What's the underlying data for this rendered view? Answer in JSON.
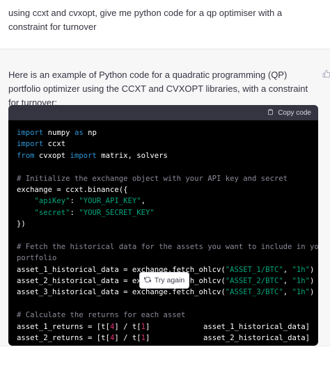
{
  "user_message": {
    "text": "using ccxt and cvxopt, give me python code for a qp optimiser with a constraint for turnover"
  },
  "assistant_message": {
    "intro": "Here is an example of Python code for a quadratic programming (QP) portfolio optimizer using the CCXT and CVXOPT libraries, with a constraint for turnover:",
    "feedback_icon": "thumbs-up-icon"
  },
  "code_block": {
    "copy_label": "Copy code",
    "copy_icon": "clipboard-icon",
    "lines": [
      [
        {
          "t": "kw",
          "v": "import"
        },
        {
          "v": " numpy "
        },
        {
          "t": "kw",
          "v": "as"
        },
        {
          "v": " np"
        }
      ],
      [
        {
          "t": "kw",
          "v": "import"
        },
        {
          "v": " ccxt"
        }
      ],
      [
        {
          "t": "kw",
          "v": "from"
        },
        {
          "v": " cvxopt "
        },
        {
          "t": "kw",
          "v": "import"
        },
        {
          "v": " matrix, solvers"
        }
      ],
      [],
      [
        {
          "t": "cm",
          "v": "# Initialize the exchange object with your API key and secret"
        }
      ],
      [
        {
          "v": "exchange = ccxt.binance({"
        }
      ],
      [
        {
          "v": "    "
        },
        {
          "t": "str",
          "v": "\"apiKey\""
        },
        {
          "v": ": "
        },
        {
          "t": "str",
          "v": "\"YOUR_API_KEY\""
        },
        {
          "v": ","
        }
      ],
      [
        {
          "v": "    "
        },
        {
          "t": "str",
          "v": "\"secret\""
        },
        {
          "v": ": "
        },
        {
          "t": "str",
          "v": "\"YOUR_SECRET_KEY\""
        }
      ],
      [
        {
          "v": "})"
        }
      ],
      [],
      [
        {
          "t": "cm",
          "v": "# Fetch the historical data for the assets you want to include in your"
        }
      ],
      [
        {
          "t": "cm",
          "v": "portfolio"
        }
      ],
      [
        {
          "v": "asset_1_historical_data = exchange.fetch_ohlcv("
        },
        {
          "t": "str",
          "v": "\"ASSET_1/BTC\""
        },
        {
          "v": ", "
        },
        {
          "t": "str",
          "v": "\"1h\""
        },
        {
          "v": ")"
        }
      ],
      [
        {
          "v": "asset_2_historical_data = exchange.fetch_ohlcv("
        },
        {
          "t": "str",
          "v": "\"ASSET_2/BTC\""
        },
        {
          "v": ", "
        },
        {
          "t": "str",
          "v": "\"1h\""
        },
        {
          "v": ")"
        }
      ],
      [
        {
          "v": "asset_3_historical_data = exchange.fetch_ohlcv("
        },
        {
          "t": "str",
          "v": "\"ASSET_3/BTC\""
        },
        {
          "v": ", "
        },
        {
          "t": "str",
          "v": "\"1h\""
        },
        {
          "v": ")"
        }
      ],
      [],
      [
        {
          "t": "cm",
          "v": "# Calculate the returns for each asset"
        }
      ],
      [
        {
          "v": "asset_1_returns = [t["
        },
        {
          "t": "num",
          "v": "4"
        },
        {
          "v": "] / t["
        },
        {
          "t": "num",
          "v": "1"
        },
        {
          "v": "] "
        },
        {
          "v": "           "
        },
        {
          "v": "asset_1_historical_data]"
        }
      ],
      [
        {
          "v": "asset_2_returns = [t["
        },
        {
          "t": "num",
          "v": "4"
        },
        {
          "v": "] / t["
        },
        {
          "t": "num",
          "v": "1"
        },
        {
          "v": "] "
        },
        {
          "v": "           "
        },
        {
          "v": "asset_2_historical_data]"
        }
      ]
    ]
  },
  "try_again": {
    "label": "Try again",
    "icon": "refresh-icon"
  }
}
